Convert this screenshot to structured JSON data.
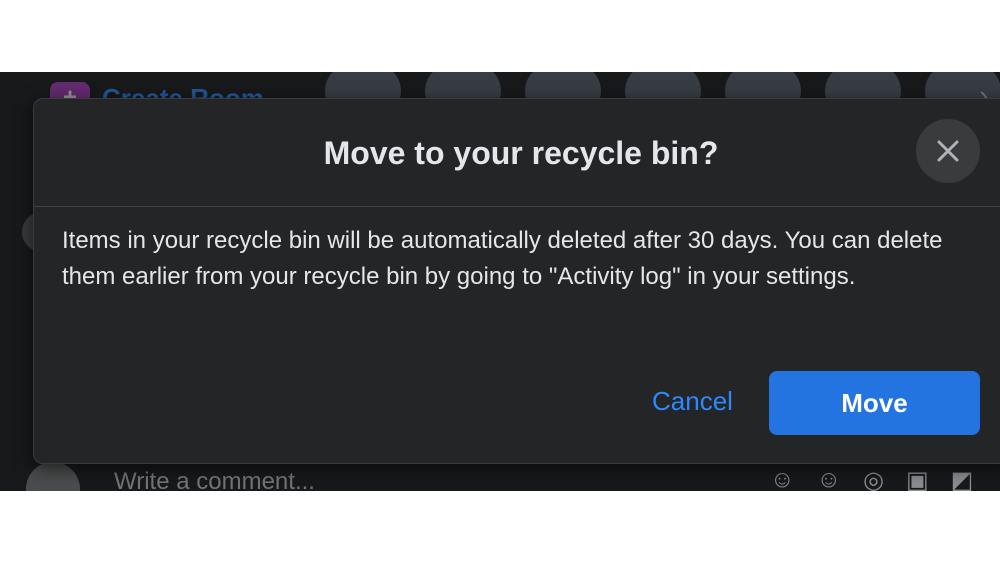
{
  "background": {
    "create_room_label": "Create Room",
    "comment_placeholder": "Write a comment..."
  },
  "dialog": {
    "title": "Move to your recycle bin?",
    "body": "Items in your recycle bin will be automatically deleted after 30 days. You can delete them earlier from your recycle bin by going to \"Activity log\" in your settings.",
    "cancel_label": "Cancel",
    "move_label": "Move",
    "close_icon": "close-icon"
  },
  "colors": {
    "accent": "#2374e1",
    "link": "#2d88ff",
    "dialog_bg": "#242526",
    "page_bg": "#18191a"
  }
}
